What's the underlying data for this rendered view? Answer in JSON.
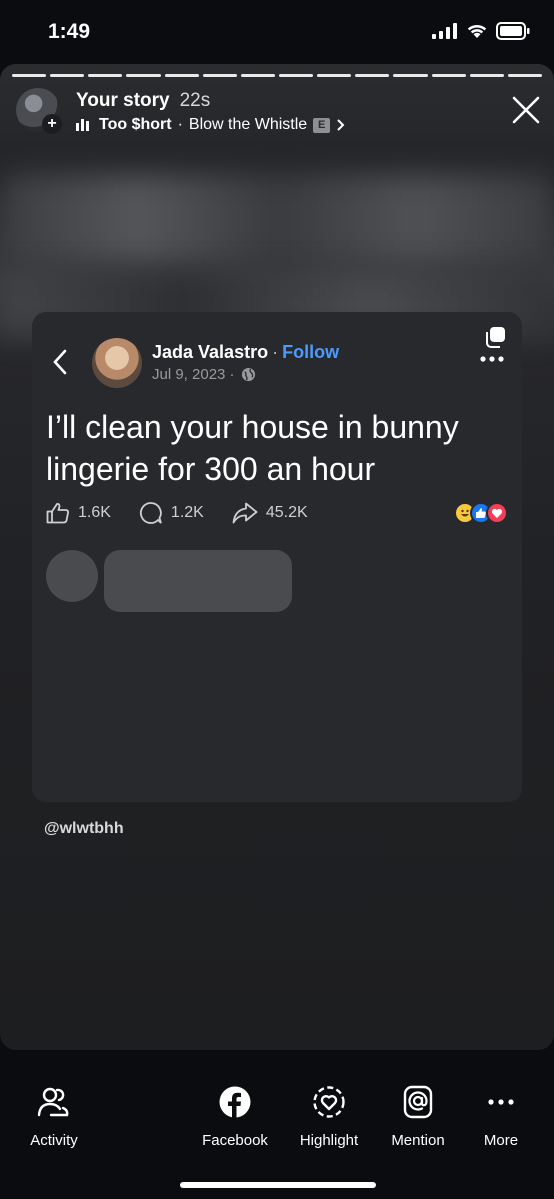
{
  "status_bar": {
    "time": "1:49"
  },
  "story": {
    "title": "Your story",
    "age": "22s",
    "music": {
      "artist": "Too $hort",
      "separator": "·",
      "song": "Blow the Whistle",
      "explicit": "E"
    },
    "segments": 14
  },
  "post": {
    "author": "Jada Valastro",
    "separator": "·",
    "follow_label": "Follow",
    "date": "Jul 9, 2023 ·",
    "text": "I’ll clean your house in bunny lingerie for 300 an hour",
    "likes": "1.6K",
    "comments": "1.2K",
    "shares": "45.2K",
    "reactions": [
      "laugh",
      "like",
      "love"
    ]
  },
  "credit": "@wlwtbhh",
  "bottom_actions": [
    {
      "label": "Activity",
      "icon": "people-icon"
    },
    {
      "label": "Facebook",
      "icon": "facebook-icon"
    },
    {
      "label": "Highlight",
      "icon": "highlight-icon"
    },
    {
      "label": "Mention",
      "icon": "mention-icon"
    },
    {
      "label": "More",
      "icon": "more-icon"
    }
  ],
  "colors": {
    "accent": "#4b9bff",
    "background": "#0b0c10",
    "card": "#28292c"
  }
}
